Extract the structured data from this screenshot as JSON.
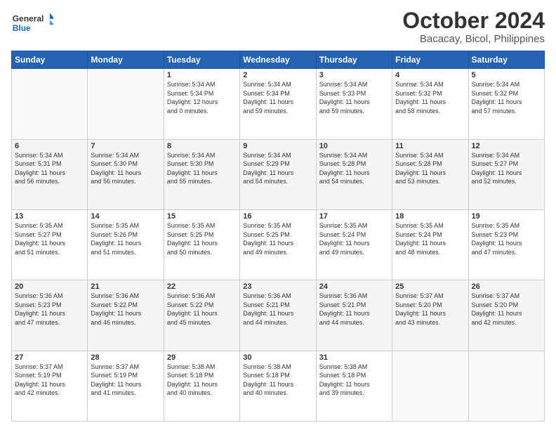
{
  "header": {
    "logo_line1": "General",
    "logo_line2": "Blue",
    "title": "October 2024",
    "subtitle": "Bacacay, Bicol, Philippines"
  },
  "calendar": {
    "headers": [
      "Sunday",
      "Monday",
      "Tuesday",
      "Wednesday",
      "Thursday",
      "Friday",
      "Saturday"
    ],
    "weeks": [
      [
        {
          "day": "",
          "info": ""
        },
        {
          "day": "",
          "info": ""
        },
        {
          "day": "1",
          "info": "Sunrise: 5:34 AM\nSunset: 5:34 PM\nDaylight: 12 hours\nand 0 minutes."
        },
        {
          "day": "2",
          "info": "Sunrise: 5:34 AM\nSunset: 5:34 PM\nDaylight: 11 hours\nand 59 minutes."
        },
        {
          "day": "3",
          "info": "Sunrise: 5:34 AM\nSunset: 5:33 PM\nDaylight: 11 hours\nand 59 minutes."
        },
        {
          "day": "4",
          "info": "Sunrise: 5:34 AM\nSunset: 5:32 PM\nDaylight: 11 hours\nand 58 minutes."
        },
        {
          "day": "5",
          "info": "Sunrise: 5:34 AM\nSunset: 5:32 PM\nDaylight: 11 hours\nand 57 minutes."
        }
      ],
      [
        {
          "day": "6",
          "info": "Sunrise: 5:34 AM\nSunset: 5:31 PM\nDaylight: 11 hours\nand 56 minutes."
        },
        {
          "day": "7",
          "info": "Sunrise: 5:34 AM\nSunset: 5:30 PM\nDaylight: 11 hours\nand 56 minutes."
        },
        {
          "day": "8",
          "info": "Sunrise: 5:34 AM\nSunset: 5:30 PM\nDaylight: 11 hours\nand 55 minutes."
        },
        {
          "day": "9",
          "info": "Sunrise: 5:34 AM\nSunset: 5:29 PM\nDaylight: 11 hours\nand 54 minutes."
        },
        {
          "day": "10",
          "info": "Sunrise: 5:34 AM\nSunset: 5:28 PM\nDaylight: 11 hours\nand 54 minutes."
        },
        {
          "day": "11",
          "info": "Sunrise: 5:34 AM\nSunset: 5:28 PM\nDaylight: 11 hours\nand 53 minutes."
        },
        {
          "day": "12",
          "info": "Sunrise: 5:34 AM\nSunset: 5:27 PM\nDaylight: 11 hours\nand 52 minutes."
        }
      ],
      [
        {
          "day": "13",
          "info": "Sunrise: 5:35 AM\nSunset: 5:27 PM\nDaylight: 11 hours\nand 51 minutes."
        },
        {
          "day": "14",
          "info": "Sunrise: 5:35 AM\nSunset: 5:26 PM\nDaylight: 11 hours\nand 51 minutes."
        },
        {
          "day": "15",
          "info": "Sunrise: 5:35 AM\nSunset: 5:25 PM\nDaylight: 11 hours\nand 50 minutes."
        },
        {
          "day": "16",
          "info": "Sunrise: 5:35 AM\nSunset: 5:25 PM\nDaylight: 11 hours\nand 49 minutes."
        },
        {
          "day": "17",
          "info": "Sunrise: 5:35 AM\nSunset: 5:24 PM\nDaylight: 11 hours\nand 49 minutes."
        },
        {
          "day": "18",
          "info": "Sunrise: 5:35 AM\nSunset: 5:24 PM\nDaylight: 11 hours\nand 48 minutes."
        },
        {
          "day": "19",
          "info": "Sunrise: 5:35 AM\nSunset: 5:23 PM\nDaylight: 11 hours\nand 47 minutes."
        }
      ],
      [
        {
          "day": "20",
          "info": "Sunrise: 5:36 AM\nSunset: 5:23 PM\nDaylight: 11 hours\nand 47 minutes."
        },
        {
          "day": "21",
          "info": "Sunrise: 5:36 AM\nSunset: 5:22 PM\nDaylight: 11 hours\nand 46 minutes."
        },
        {
          "day": "22",
          "info": "Sunrise: 5:36 AM\nSunset: 5:22 PM\nDaylight: 11 hours\nand 45 minutes."
        },
        {
          "day": "23",
          "info": "Sunrise: 5:36 AM\nSunset: 5:21 PM\nDaylight: 11 hours\nand 44 minutes."
        },
        {
          "day": "24",
          "info": "Sunrise: 5:36 AM\nSunset: 5:21 PM\nDaylight: 11 hours\nand 44 minutes."
        },
        {
          "day": "25",
          "info": "Sunrise: 5:37 AM\nSunset: 5:20 PM\nDaylight: 11 hours\nand 43 minutes."
        },
        {
          "day": "26",
          "info": "Sunrise: 5:37 AM\nSunset: 5:20 PM\nDaylight: 11 hours\nand 42 minutes."
        }
      ],
      [
        {
          "day": "27",
          "info": "Sunrise: 5:37 AM\nSunset: 5:19 PM\nDaylight: 11 hours\nand 42 minutes."
        },
        {
          "day": "28",
          "info": "Sunrise: 5:37 AM\nSunset: 5:19 PM\nDaylight: 11 hours\nand 41 minutes."
        },
        {
          "day": "29",
          "info": "Sunrise: 5:38 AM\nSunset: 5:18 PM\nDaylight: 11 hours\nand 40 minutes."
        },
        {
          "day": "30",
          "info": "Sunrise: 5:38 AM\nSunset: 5:18 PM\nDaylight: 11 hours\nand 40 minutes."
        },
        {
          "day": "31",
          "info": "Sunrise: 5:38 AM\nSunset: 5:18 PM\nDaylight: 11 hours\nand 39 minutes."
        },
        {
          "day": "",
          "info": ""
        },
        {
          "day": "",
          "info": ""
        }
      ]
    ]
  }
}
